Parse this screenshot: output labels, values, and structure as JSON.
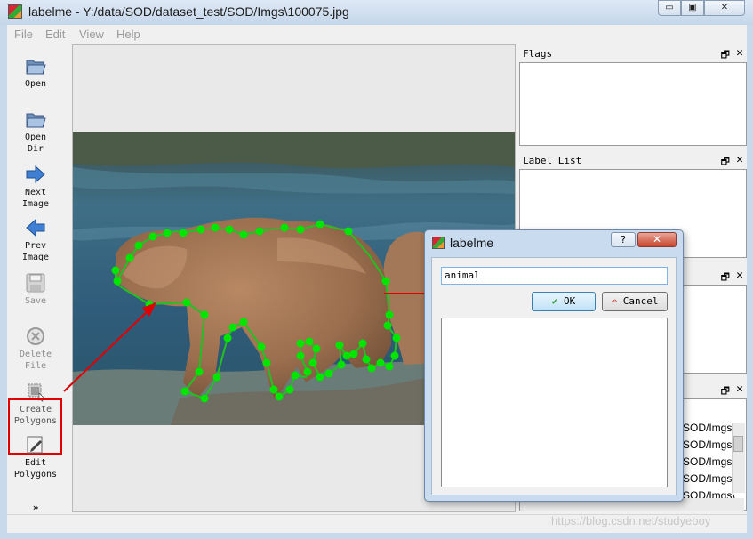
{
  "window": {
    "title": "labelme - Y:/data/SOD/dataset_test/SOD/Imgs\\100075.jpg",
    "controls": {
      "minimize": "▭",
      "maximize": "▣",
      "close": "✕"
    }
  },
  "menu": [
    "File",
    "Edit",
    "View",
    "Help"
  ],
  "toolbar": {
    "items": [
      {
        "label": "Open",
        "icon": "folder-open-icon"
      },
      {
        "label": "Open\nDir",
        "icon": "folder-open-icon"
      },
      {
        "label": "Next\nImage",
        "icon": "arrow-right-icon"
      },
      {
        "label": "Prev\nImage",
        "icon": "arrow-left-icon"
      },
      {
        "label": "Save",
        "icon": "save-icon"
      },
      {
        "label": "Delete\nFile",
        "icon": "delete-icon"
      },
      {
        "label": "Create\nPolygons",
        "icon": "create-polygon-icon"
      },
      {
        "label": "Edit\nPolygons",
        "icon": "edit-polygon-icon"
      }
    ],
    "more": "»",
    "accent": "#e00000"
  },
  "docks": {
    "flags": {
      "title": "Flags"
    },
    "label_list": {
      "title": "Label List"
    },
    "float_icon": "🗗",
    "close_icon": "✕"
  },
  "file_list": {
    "rows": [
      "SOD/Imgs\\",
      "SOD/Imgs\\",
      "SOD/Imgs\\",
      "SOD/Imgs\\",
      "SOD/Imgs\\"
    ]
  },
  "dialog": {
    "title": "labelme",
    "help": "?",
    "close": "✕",
    "label_value": "animal",
    "ok": "OK",
    "cancel": "Cancel"
  },
  "colors": {
    "polygon": "#00e600",
    "polygon_edge": "#22c022",
    "arrow": "#e00000",
    "accent": "#3c7fb1"
  },
  "watermark": "https://blog.csdn.net/studyeboy"
}
